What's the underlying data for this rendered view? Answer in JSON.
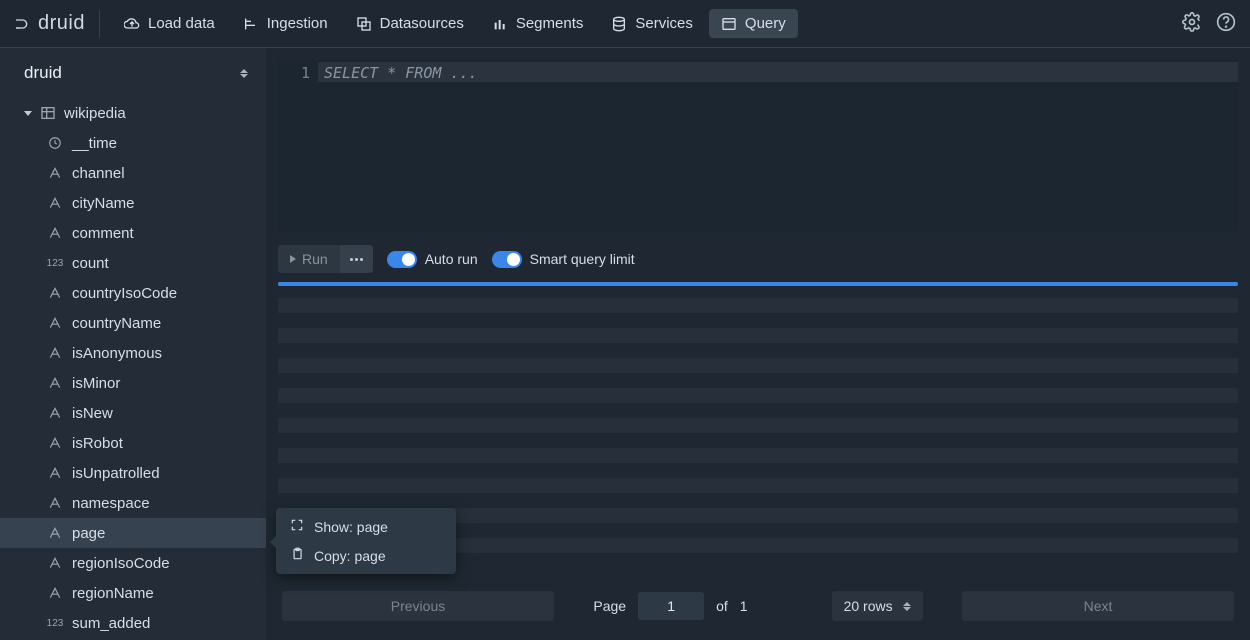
{
  "brand": "druid",
  "nav": {
    "load_data": "Load data",
    "ingestion": "Ingestion",
    "datasources": "Datasources",
    "segments": "Segments",
    "services": "Services",
    "query": "Query"
  },
  "sidebar": {
    "schema": "druid",
    "datasource": "wikipedia",
    "columns": [
      {
        "type": "time",
        "name": "__time"
      },
      {
        "type": "string",
        "name": "channel"
      },
      {
        "type": "string",
        "name": "cityName"
      },
      {
        "type": "string",
        "name": "comment"
      },
      {
        "type": "number",
        "name": "count"
      },
      {
        "type": "string",
        "name": "countryIsoCode"
      },
      {
        "type": "string",
        "name": "countryName"
      },
      {
        "type": "string",
        "name": "isAnonymous"
      },
      {
        "type": "string",
        "name": "isMinor"
      },
      {
        "type": "string",
        "name": "isNew"
      },
      {
        "type": "string",
        "name": "isRobot"
      },
      {
        "type": "string",
        "name": "isUnpatrolled"
      },
      {
        "type": "string",
        "name": "namespace"
      },
      {
        "type": "string",
        "name": "page"
      },
      {
        "type": "string",
        "name": "regionIsoCode"
      },
      {
        "type": "string",
        "name": "regionName"
      },
      {
        "type": "number",
        "name": "sum_added"
      }
    ],
    "selected_index": 13
  },
  "context_menu": {
    "show_label": "Show: page",
    "copy_label": "Copy: page"
  },
  "editor": {
    "line_number": "1",
    "placeholder": "SELECT * FROM ..."
  },
  "runbar": {
    "run_label": "Run",
    "auto_run_label": "Auto run",
    "smart_limit_label": "Smart query limit"
  },
  "pager": {
    "previous": "Previous",
    "next": "Next",
    "page_label": "Page",
    "page_value": "1",
    "of_label": "of",
    "total_pages": "1",
    "rows_label": "20 rows"
  }
}
